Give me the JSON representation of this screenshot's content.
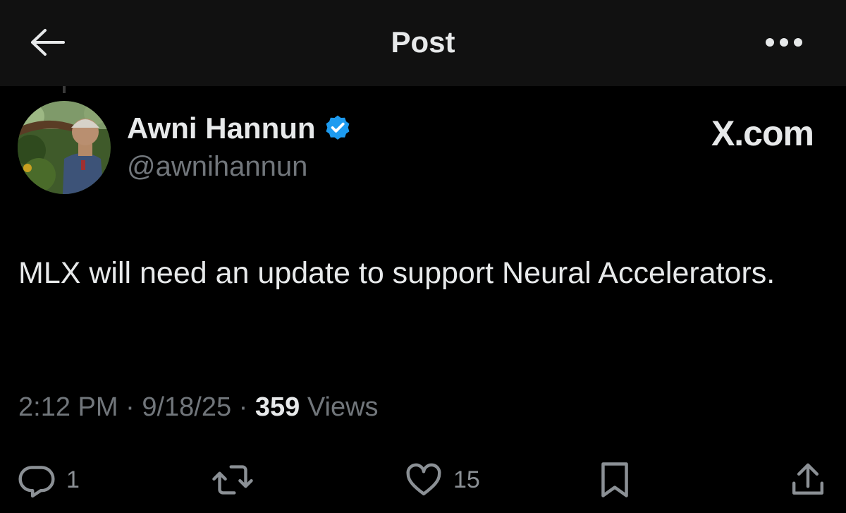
{
  "header": {
    "title": "Post",
    "back_icon": "arrow-left-icon",
    "more_icon": "more-horizontal-icon"
  },
  "author": {
    "display_name": "Awni Hannun",
    "handle": "@awnihannun",
    "verified": true,
    "verified_color": "#1d9bf0"
  },
  "watermark": "X.com",
  "tweet": {
    "text": "MLX will need an update to support Neural Accelerators."
  },
  "meta": {
    "time": "2:12 PM",
    "sep1": " · ",
    "date": "9/18/25",
    "sep2": " · ",
    "views_count": "359",
    "views_label": " Views"
  },
  "actions": {
    "reply": {
      "icon": "reply-icon",
      "count": "1"
    },
    "repost": {
      "icon": "repost-icon",
      "count": ""
    },
    "like": {
      "icon": "heart-icon",
      "count": "15"
    },
    "bookmark": {
      "icon": "bookmark-icon"
    },
    "share": {
      "icon": "share-icon"
    }
  },
  "colors": {
    "background": "#000000",
    "header_background": "#111111",
    "text": "#e7e9ea",
    "secondary_text": "#71767b"
  }
}
